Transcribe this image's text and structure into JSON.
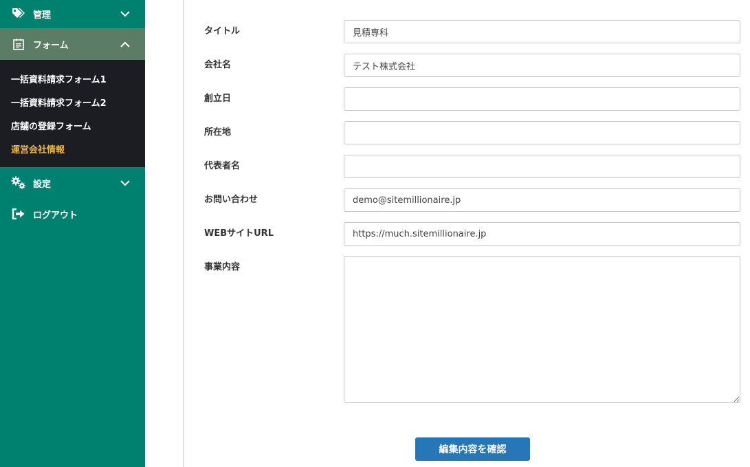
{
  "sidebar": {
    "kanri": {
      "label": "管理",
      "icon": "tags-icon"
    },
    "form": {
      "label": "フォーム",
      "icon": "form-icon"
    },
    "form_items": [
      {
        "label": "一括資料請求フォーム1"
      },
      {
        "label": "一括資料請求フォーム2"
      },
      {
        "label": "店舗の登録フォーム"
      },
      {
        "label": "運営会社情報"
      }
    ],
    "settings": {
      "label": "設定",
      "icon": "gears-icon"
    },
    "logout": {
      "label": "ログアウト",
      "icon": "sign-out-icon"
    }
  },
  "form": {
    "title": {
      "label": "タイトル",
      "value": "見積専科"
    },
    "company": {
      "label": "会社名",
      "value": "テスト株式会社"
    },
    "founded": {
      "label": "創立日",
      "value": ""
    },
    "address": {
      "label": "所在地",
      "value": ""
    },
    "representative": {
      "label": "代表者名",
      "value": ""
    },
    "contact": {
      "label": "お問い合わせ",
      "value": "demo@sitemillionaire.jp"
    },
    "website": {
      "label": "WEBサイトURL",
      "value": "https://much.sitemillionaire.jp"
    },
    "business": {
      "label": "事業内容",
      "value": ""
    }
  },
  "confirm_button": "編集内容を確認",
  "colors": {
    "sidebar": "#00806f",
    "active_item": "#5b7d66",
    "submenu": "#1b1d22",
    "current_link": "#f2b33a",
    "button": "#2677b8"
  }
}
